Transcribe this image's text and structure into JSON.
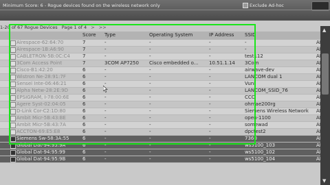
{
  "topbar": {
    "minimum_score": "Minimum Score: 6 - Rogue devices found on the wireless network only",
    "exclude_adhoc": "Exclude Ad-hoc"
  },
  "pager": {
    "range": "1-20 of 67 Rogue Devices",
    "page": "Page 1 of 4",
    "next": ">",
    "last": ">>"
  },
  "columns": {
    "score": "Score",
    "type": "Type",
    "os": "Operating System",
    "ip": "IP Address",
    "ssid": "SSID",
    "last": ""
  },
  "rows": [
    {
      "name": "Airespace-62:64:70",
      "score": "7",
      "type": "-",
      "os": "-",
      "ip": "-",
      "ssid": "-",
      "last": "AP"
    },
    {
      "name": "Airespace-1B:A6:90",
      "score": "7",
      "type": "-",
      "os": "-",
      "ip": "-",
      "ssid": "-",
      "last": "AP"
    },
    {
      "name": "CABLETRON-5B:0C:C4",
      "score": "7",
      "type": "-",
      "os": "-",
      "ip": "-",
      "ssid": "test112",
      "last": "AP"
    },
    {
      "name": "3Com Access Point",
      "score": "7",
      "type": "3COM AP7250",
      "os": "Cisco embedded o...",
      "ip": "10.51.1.14",
      "ssid": "3Com",
      "last": "AP"
    },
    {
      "name": "Cisco-B1:42:20",
      "score": "6",
      "type": "-",
      "os": "-",
      "ip": "-",
      "ssid": "airwave-dev",
      "last": "AP"
    },
    {
      "name": "Wistron Ne-28:91:7F",
      "score": "6",
      "type": "-",
      "os": "-",
      "ip": "-",
      "ssid": "LANCOM dual 1",
      "last": "AP"
    },
    {
      "name": "Sensei Inte-06:46:21",
      "score": "6",
      "type": "-",
      "os": "-",
      "ip": "-",
      "ssid": "Vuni",
      "last": "AP"
    },
    {
      "name": "Alpha Netw-28:2E:9D",
      "score": "6",
      "type": "-",
      "os": "-",
      "ip": "-",
      "ssid": "LANCOM_SSID_76",
      "last": "AP"
    },
    {
      "name": "EPSIGRAM, I-78:00:6E",
      "score": "6",
      "type": "-",
      "os": "-",
      "ip": "-",
      "ssid": "CCC",
      "last": "AP"
    },
    {
      "name": "Agere Syst-02:04:05",
      "score": "6",
      "type": "-",
      "os": "-",
      "ip": "-",
      "ssid": "ohmae200rg",
      "last": "AP"
    },
    {
      "name": "D-Link Cor-C2:1D:80",
      "score": "6",
      "type": "-",
      "os": "-",
      "ip": "-",
      "ssid": "Siemens Wireless Network",
      "last": "AP"
    },
    {
      "name": "Ambit Micr-5B:43:BE",
      "score": "6",
      "type": "-",
      "os": "-",
      "ip": "-",
      "ssid": "open-1100",
      "last": "AP"
    },
    {
      "name": "Ambit Micr-5B:43:7A",
      "score": "6",
      "type": "-",
      "os": "-",
      "ip": "-",
      "ssid": "somewad",
      "last": "AP"
    },
    {
      "name": "ACCTON-69:E5:E8",
      "score": "6",
      "type": "-",
      "os": "-",
      "ip": "-",
      "ssid": "dpctest2",
      "last": "AP"
    },
    {
      "name": "Siemens Sw-58:3A:55",
      "score": "6",
      "type": "-",
      "os": "-",
      "ip": "-",
      "ssid": "7360",
      "last": "AP"
    },
    {
      "name": "Global Dat-94:95:9A",
      "score": "6",
      "type": "-",
      "os": "-",
      "ip": "-",
      "ssid": "ws5100_103",
      "last": "AP"
    },
    {
      "name": "Global Dat-94:95:99",
      "score": "6",
      "type": "-",
      "os": "-",
      "ip": "-",
      "ssid": "ws5100_102",
      "last": "AP"
    },
    {
      "name": "Global Dat-94:95:9B",
      "score": "6",
      "type": "-",
      "os": "-",
      "ip": "-",
      "ssid": "ws5100_104",
      "last": "AP"
    }
  ],
  "colors": {
    "highlight": "#19e619"
  }
}
